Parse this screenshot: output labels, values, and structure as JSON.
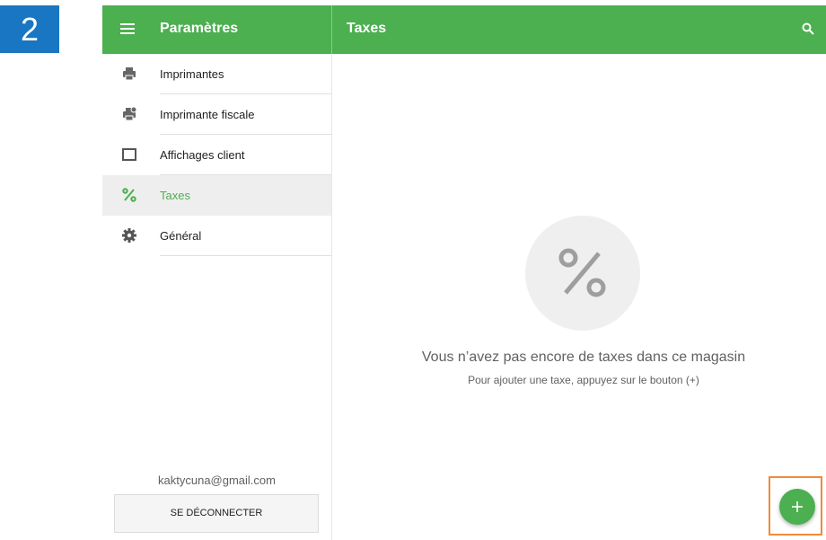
{
  "step_number": "2",
  "colors": {
    "accent": "#4caf50",
    "step_badge": "#1976c2",
    "highlight": "#f08a3c"
  },
  "appbar": {
    "menu_icon": "hamburger-icon",
    "left_title": "Paramètres",
    "right_title": "Taxes",
    "search_icon": "search-icon"
  },
  "sidebar": {
    "items": [
      {
        "label": "Imprimantes",
        "icon": "printer-icon",
        "active": false
      },
      {
        "label": "Imprimante fiscale",
        "icon": "fiscal-printer-icon",
        "active": false
      },
      {
        "label": "Affichages client",
        "icon": "display-icon",
        "active": false
      },
      {
        "label": "Taxes",
        "icon": "percent-icon",
        "active": true
      },
      {
        "label": "Général",
        "icon": "gear-icon",
        "active": false
      }
    ],
    "email": "kaktycuna@gmail.com",
    "logout_label": "SE DÉCONNECTER"
  },
  "main": {
    "empty_icon": "percent-icon",
    "empty_title": "Vous n’avez pas encore de taxes dans ce magasin",
    "empty_subtitle": "Pour ajouter une taxe, appuyez sur le bouton (+)",
    "fab_icon": "plus-icon"
  }
}
